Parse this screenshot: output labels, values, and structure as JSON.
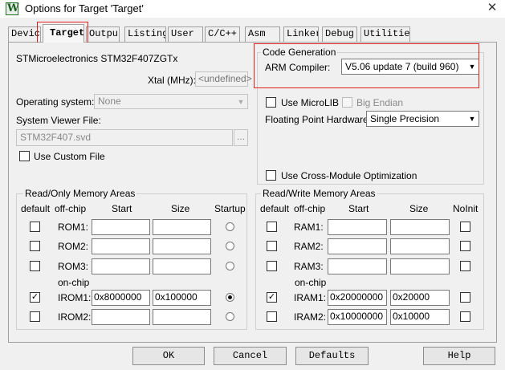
{
  "window": {
    "title": "Options for Target 'Target'",
    "app_icon_glyph": "W",
    "close_glyph": "✕"
  },
  "tabs": [
    {
      "label": "Device"
    },
    {
      "label": "Target"
    },
    {
      "label": "Output"
    },
    {
      "label": "Listing"
    },
    {
      "label": "User"
    },
    {
      "label": "C/C++"
    },
    {
      "label": "Asm"
    },
    {
      "label": "Linker"
    },
    {
      "label": "Debug"
    },
    {
      "label": "Utilities"
    }
  ],
  "active_tab": "Target",
  "device_name": "STMicroelectronics STM32F407ZGTx",
  "xtal": {
    "label": "Xtal (MHz):",
    "value": "<undefined>"
  },
  "os": {
    "label": "Operating system:",
    "value": "None"
  },
  "svd": {
    "label": "System Viewer File:",
    "value": "STM32F407.svd",
    "browse": "..."
  },
  "use_custom_file": {
    "label": "Use Custom File",
    "checked": false
  },
  "code_gen": {
    "title": "Code Generation",
    "compiler_label": "ARM Compiler:",
    "compiler_value": "V5.06 update 7 (build 960)",
    "microlib": {
      "label": "Use MicroLIB",
      "checked": false
    },
    "big_endian": {
      "label": "Big Endian",
      "checked": false
    },
    "fpu_label": "Floating Point Hardware:",
    "fpu_value": "Single Precision",
    "cross_module": {
      "label": "Use Cross-Module Optimization",
      "checked": false
    }
  },
  "ro_mem": {
    "title": "Read/Only Memory Areas",
    "headers": {
      "default": "default",
      "offchip": "off-chip",
      "start": "Start",
      "size": "Size",
      "startup": "Startup"
    },
    "onchip_label": "on-chip",
    "rows": [
      {
        "name": "ROM1:",
        "start": "",
        "size": "",
        "default": false,
        "startup": false
      },
      {
        "name": "ROM2:",
        "start": "",
        "size": "",
        "default": false,
        "startup": false
      },
      {
        "name": "ROM3:",
        "start": "",
        "size": "",
        "default": false,
        "startup": false
      },
      {
        "name": "IROM1:",
        "start": "0x8000000",
        "size": "0x100000",
        "default": true,
        "startup": true
      },
      {
        "name": "IROM2:",
        "start": "",
        "size": "",
        "default": false,
        "startup": false
      }
    ]
  },
  "rw_mem": {
    "title": "Read/Write Memory Areas",
    "headers": {
      "default": "default",
      "offchip": "off-chip",
      "start": "Start",
      "size": "Size",
      "noinit": "NoInit"
    },
    "onchip_label": "on-chip",
    "rows": [
      {
        "name": "RAM1:",
        "start": "",
        "size": "",
        "default": false,
        "noinit": false
      },
      {
        "name": "RAM2:",
        "start": "",
        "size": "",
        "default": false,
        "noinit": false
      },
      {
        "name": "RAM3:",
        "start": "",
        "size": "",
        "default": false,
        "noinit": false
      },
      {
        "name": "IRAM1:",
        "start": "0x20000000",
        "size": "0x20000",
        "default": true,
        "noinit": false
      },
      {
        "name": "IRAM2:",
        "start": "0x10000000",
        "size": "0x10000",
        "default": false,
        "noinit": false
      }
    ]
  },
  "buttons": {
    "ok": "OK",
    "cancel": "Cancel",
    "defaults": "Defaults",
    "help": "Help"
  },
  "check_glyph": "✓",
  "dropdown_glyph": "▼",
  "colors": {
    "highlight": "#e02020",
    "window_bg": "#f0f0f0"
  }
}
